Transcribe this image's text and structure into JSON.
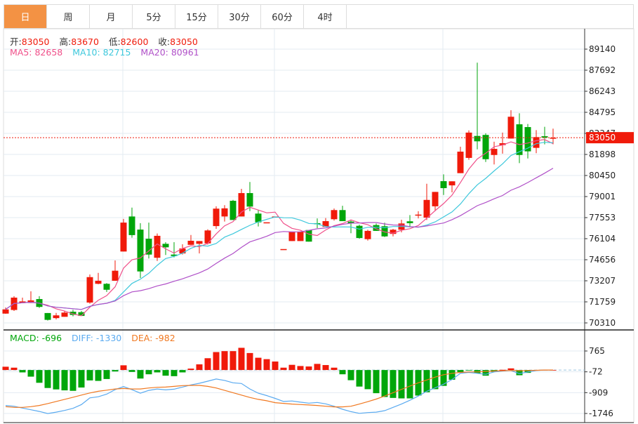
{
  "tabs": [
    {
      "label": "日",
      "active": true
    },
    {
      "label": "周"
    },
    {
      "label": "月"
    },
    {
      "label": "5分"
    },
    {
      "label": "15分"
    },
    {
      "label": "30分"
    },
    {
      "label": "60分"
    },
    {
      "label": "4时"
    }
  ],
  "legend": {
    "open_label": "开:",
    "open": "83050",
    "high_label": "高:",
    "high": "83670",
    "low_label": "低:",
    "low": "82600",
    "close_label": "收:",
    "close": "83050",
    "ma5": "MA5: 82658",
    "ma10": "MA10: 82715",
    "ma20": "MA20: 80961",
    "macd": "MACD: -696",
    "diff": "DIFF: -1330",
    "dea": "DEA: -982"
  },
  "colors": {
    "up": "#f01a0a",
    "down": "#00a60a",
    "ma5": "#f0508a",
    "ma10": "#3ec8dc",
    "ma20": "#b050c8",
    "diff": "#5aaaf0",
    "dea": "#f07820",
    "tab_active": "#f39244"
  },
  "chart_data": [
    {
      "type": "candlestick",
      "title": "",
      "ylim": [
        70310,
        89140
      ],
      "y_ticks": [
        "89140",
        "87692",
        "86243",
        "84795",
        "83347",
        "81898",
        "80450",
        "79001",
        "77553",
        "76104",
        "74656",
        "73207",
        "71759",
        "70310"
      ],
      "last_price": "83050",
      "grid": true,
      "ohlc": [
        [
          70950,
          71370,
          70940,
          71240
        ],
        [
          71200,
          72150,
          71130,
          72050
        ],
        [
          71710,
          72050,
          71710,
          71790
        ],
        [
          71680,
          72480,
          71680,
          71860
        ],
        [
          71950,
          72150,
          71340,
          71410
        ],
        [
          70990,
          70990,
          70470,
          70520
        ],
        [
          70640,
          71000,
          70550,
          70830
        ],
        [
          70730,
          71130,
          70730,
          71020
        ],
        [
          71080,
          71210,
          70760,
          70860
        ],
        [
          71050,
          71130,
          70790,
          70790
        ],
        [
          71710,
          73640,
          71630,
          73460
        ],
        [
          73000,
          73750,
          72970,
          73210
        ],
        [
          73000,
          73050,
          72440,
          72590
        ],
        [
          73210,
          74610,
          73210,
          73900
        ],
        [
          75220,
          77460,
          75220,
          77210
        ],
        [
          77630,
          78240,
          76170,
          76350
        ],
        [
          76730,
          77170,
          73400,
          73850
        ],
        [
          76100,
          77210,
          74740,
          75010
        ],
        [
          74790,
          76460,
          74570,
          76300
        ],
        [
          75750,
          75860,
          74980,
          75510
        ],
        [
          75010,
          75860,
          74820,
          74910
        ],
        [
          75090,
          75720,
          75010,
          75430
        ],
        [
          75680,
          76360,
          75680,
          75960
        ],
        [
          75750,
          75940,
          75090,
          75940
        ],
        [
          75780,
          76750,
          75700,
          76670
        ],
        [
          76970,
          78330,
          76780,
          78170
        ],
        [
          77630,
          78410,
          77280,
          78190
        ],
        [
          78710,
          78770,
          77390,
          77390
        ],
        [
          77630,
          79530,
          77630,
          79240
        ],
        [
          79240,
          80000,
          78000,
          78310
        ],
        [
          77830,
          78070,
          76940,
          77230
        ],
        [
          77230,
          77230,
          77230,
          77230
        ],
        [
          77630,
          77630,
          77630,
          77630
        ],
        [
          75390,
          75390,
          75390,
          75390
        ],
        [
          75940,
          76590,
          75940,
          76590
        ],
        [
          75940,
          76590,
          75940,
          76590
        ],
        [
          76700,
          76700,
          75900,
          75900
        ],
        [
          77170,
          77500,
          76830,
          77130
        ],
        [
          76910,
          77520,
          76910,
          77310
        ],
        [
          77440,
          78180,
          77350,
          78070
        ],
        [
          78070,
          78370,
          77310,
          77310
        ],
        [
          77280,
          77350,
          76480,
          77150
        ],
        [
          76990,
          77070,
          76100,
          76150
        ],
        [
          76070,
          76720,
          75970,
          76640
        ],
        [
          77040,
          77150,
          76640,
          76640
        ],
        [
          76960,
          77200,
          76220,
          76260
        ],
        [
          76430,
          76780,
          76260,
          76720
        ],
        [
          76720,
          77410,
          76540,
          77150
        ],
        [
          77300,
          77730,
          76880,
          77170
        ],
        [
          77750,
          77990,
          77500,
          77760
        ],
        [
          77550,
          79880,
          77390,
          78770
        ],
        [
          78330,
          79320,
          78000,
          79320
        ],
        [
          80060,
          80530,
          79110,
          79580
        ],
        [
          79770,
          80050,
          79290,
          80050
        ],
        [
          80610,
          82430,
          80610,
          82090
        ],
        [
          81660,
          83550,
          81530,
          83400
        ],
        [
          83170,
          88210,
          82250,
          82800
        ],
        [
          83240,
          83350,
          81380,
          81570
        ],
        [
          81860,
          82770,
          81210,
          82280
        ],
        [
          82540,
          83400,
          81950,
          82670
        ],
        [
          82990,
          84940,
          82990,
          84490
        ],
        [
          83970,
          84730,
          81300,
          81860
        ],
        [
          83780,
          83990,
          81620,
          82110
        ],
        [
          82350,
          83570,
          81980,
          83090
        ],
        [
          83150,
          83800,
          82590,
          83060
        ],
        [
          83050,
          83670,
          82600,
          83050
        ]
      ],
      "ma_periods": [
        5,
        10,
        20
      ]
    },
    {
      "type": "macd",
      "ylim": [
        -1746,
        765
      ],
      "y_ticks": [
        "765",
        "-72",
        "-909",
        "-1746"
      ],
      "histogram": [
        133,
        95,
        -95,
        -266,
        -513,
        -722,
        -779,
        -817,
        -836,
        -703,
        -418,
        -437,
        -361,
        -57,
        190,
        -76,
        -342,
        -171,
        -95,
        -228,
        -247,
        -95,
        57,
        228,
        475,
        722,
        760,
        760,
        893,
        684,
        494,
        437,
        342,
        95,
        209,
        161,
        143,
        247,
        200,
        95,
        -171,
        -409,
        -665,
        -770,
        -931,
        -1083,
        -1121,
        -1140,
        -1140,
        -1026,
        -893,
        -770,
        -637,
        -390,
        -86,
        -10,
        -133,
        -228,
        -76,
        10,
        66,
        -209,
        -114,
        -10,
        5,
        0
      ],
      "diff": [
        -1425,
        -1454,
        -1530,
        -1596,
        -1663,
        -1748,
        -1691,
        -1625,
        -1539,
        -1387,
        -1121,
        -1074,
        -969,
        -789,
        -665,
        -789,
        -931,
        -817,
        -760,
        -798,
        -770,
        -684,
        -599,
        -532,
        -447,
        -361,
        -418,
        -513,
        -542,
        -760,
        -931,
        -1026,
        -1140,
        -1264,
        -1245,
        -1292,
        -1330,
        -1302,
        -1359,
        -1454,
        -1577,
        -1672,
        -1739,
        -1710,
        -1691,
        -1634,
        -1501,
        -1368,
        -1216,
        -1045,
        -855,
        -713,
        -570,
        -380,
        -133,
        -95,
        -133,
        -171,
        -76,
        -38,
        -19,
        -143,
        -76,
        -19,
        0,
        0
      ],
      "dea": [
        -1473,
        -1501,
        -1501,
        -1473,
        -1425,
        -1349,
        -1264,
        -1178,
        -1093,
        -1007,
        -922,
        -855,
        -808,
        -760,
        -741,
        -760,
        -760,
        -722,
        -694,
        -684,
        -656,
        -627,
        -618,
        -618,
        -656,
        -722,
        -817,
        -912,
        -1007,
        -1102,
        -1178,
        -1235,
        -1311,
        -1340,
        -1368,
        -1387,
        -1406,
        -1425,
        -1454,
        -1482,
        -1482,
        -1454,
        -1368,
        -1273,
        -1169,
        -1045,
        -912,
        -779,
        -646,
        -513,
        -399,
        -285,
        -190,
        -133,
        -95,
        -76,
        -76,
        -57,
        -38,
        -29,
        -19,
        -29,
        -19,
        -10,
        0,
        0
      ]
    }
  ]
}
